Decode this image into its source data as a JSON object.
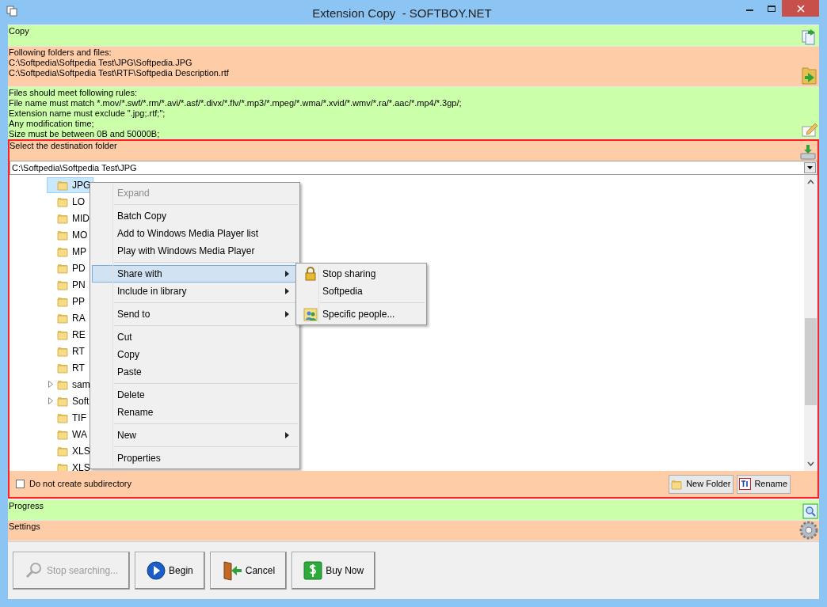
{
  "window": {
    "title": "Extension Copy  - SOFTBOY.NET"
  },
  "copy_section": {
    "title": "Copy"
  },
  "source_section": {
    "title": "Following folders and files:",
    "lines": [
      "C:\\Softpedia\\Softpedia Test\\JPG\\Softpedia.JPG",
      "C:\\Softpedia\\Softpedia Test\\RTF\\Softpedia Description.rtf"
    ]
  },
  "rules_section": {
    "title": "Files should meet following rules:",
    "lines": [
      "File name must match *.mov/*.swf/*.rm/*.avi/*.asf/*.divx/*.flv/*.mp3/*.mpeg/*.wma/*.xvid/*.wmv/*.ra/*.aac/*.mp4/*.3gp/;",
      "Extension name must exclude \".jpg;.rtf;\";",
      "Any modification time;",
      "Size must be between 0B and 50000B;"
    ]
  },
  "destination_section": {
    "title": "Select the destination folder",
    "path": "C:\\Softpedia\\Softpedia Test\\JPG",
    "tree": [
      {
        "label": "JPG",
        "selected": true,
        "expandable": false
      },
      {
        "label": "LO",
        "selected": false,
        "expandable": false
      },
      {
        "label": "MID",
        "selected": false,
        "expandable": false
      },
      {
        "label": "MO",
        "selected": false,
        "expandable": false
      },
      {
        "label": "MP",
        "selected": false,
        "expandable": false
      },
      {
        "label": "PD",
        "selected": false,
        "expandable": false
      },
      {
        "label": "PN",
        "selected": false,
        "expandable": false
      },
      {
        "label": "PP",
        "selected": false,
        "expandable": false
      },
      {
        "label": "RA",
        "selected": false,
        "expandable": false
      },
      {
        "label": "RE",
        "selected": false,
        "expandable": false
      },
      {
        "label": "RT",
        "selected": false,
        "expandable": false
      },
      {
        "label": "RT",
        "selected": false,
        "expandable": false
      },
      {
        "label": "sam",
        "selected": false,
        "expandable": true
      },
      {
        "label": "Soft",
        "selected": false,
        "expandable": true
      },
      {
        "label": "TIF",
        "selected": false,
        "expandable": false
      },
      {
        "label": "WA",
        "selected": false,
        "expandable": false
      },
      {
        "label": "XLS",
        "selected": false,
        "expandable": false
      },
      {
        "label": "XLS",
        "selected": false,
        "expandable": false
      }
    ],
    "context_menu": [
      {
        "kind": "item",
        "label": "Expand",
        "disabled": true,
        "selected": false,
        "submenu": false
      },
      {
        "kind": "separator"
      },
      {
        "kind": "item",
        "label": "Batch Copy",
        "disabled": false,
        "selected": false,
        "submenu": false
      },
      {
        "kind": "item",
        "label": "Add to Windows Media Player list",
        "disabled": false,
        "selected": false,
        "submenu": false
      },
      {
        "kind": "item",
        "label": "Play with Windows Media Player",
        "disabled": false,
        "selected": false,
        "submenu": false
      },
      {
        "kind": "separator"
      },
      {
        "kind": "item",
        "label": "Share with",
        "disabled": false,
        "selected": true,
        "submenu": true
      },
      {
        "kind": "item",
        "label": "Include in library",
        "disabled": false,
        "selected": false,
        "submenu": true
      },
      {
        "kind": "separator"
      },
      {
        "kind": "item",
        "label": "Send to",
        "disabled": false,
        "selected": false,
        "submenu": true
      },
      {
        "kind": "separator"
      },
      {
        "kind": "item",
        "label": "Cut",
        "disabled": false,
        "selected": false,
        "submenu": false
      },
      {
        "kind": "item",
        "label": "Copy",
        "disabled": false,
        "selected": false,
        "submenu": false
      },
      {
        "kind": "item",
        "label": "Paste",
        "disabled": false,
        "selected": false,
        "submenu": false
      },
      {
        "kind": "separator"
      },
      {
        "kind": "item",
        "label": "Delete",
        "disabled": false,
        "selected": false,
        "submenu": false
      },
      {
        "kind": "item",
        "label": "Rename",
        "disabled": false,
        "selected": false,
        "submenu": false
      },
      {
        "kind": "separator"
      },
      {
        "kind": "item",
        "label": "New",
        "disabled": false,
        "selected": false,
        "submenu": true
      },
      {
        "kind": "separator"
      },
      {
        "kind": "item",
        "label": "Properties",
        "disabled": false,
        "selected": false,
        "submenu": false
      }
    ],
    "share_submenu": [
      {
        "kind": "item",
        "label": "Stop sharing"
      },
      {
        "kind": "item",
        "label": "Softpedia"
      },
      {
        "kind": "separator"
      },
      {
        "kind": "item",
        "label": "Specific people..."
      }
    ],
    "subdirectory_checkbox": {
      "label": "Do not create subdirectory",
      "checked": false
    },
    "buttons": [
      {
        "label": "New Folder"
      },
      {
        "label": "Rename"
      }
    ]
  },
  "progress_section": {
    "title": "Progress"
  },
  "settings_section": {
    "title": "Settings"
  },
  "buttons": [
    {
      "label": "Stop searching...",
      "disabled": true
    },
    {
      "label": "Begin",
      "disabled": false
    },
    {
      "label": "Cancel",
      "disabled": false
    },
    {
      "label": "Buy Now",
      "disabled": false
    }
  ]
}
